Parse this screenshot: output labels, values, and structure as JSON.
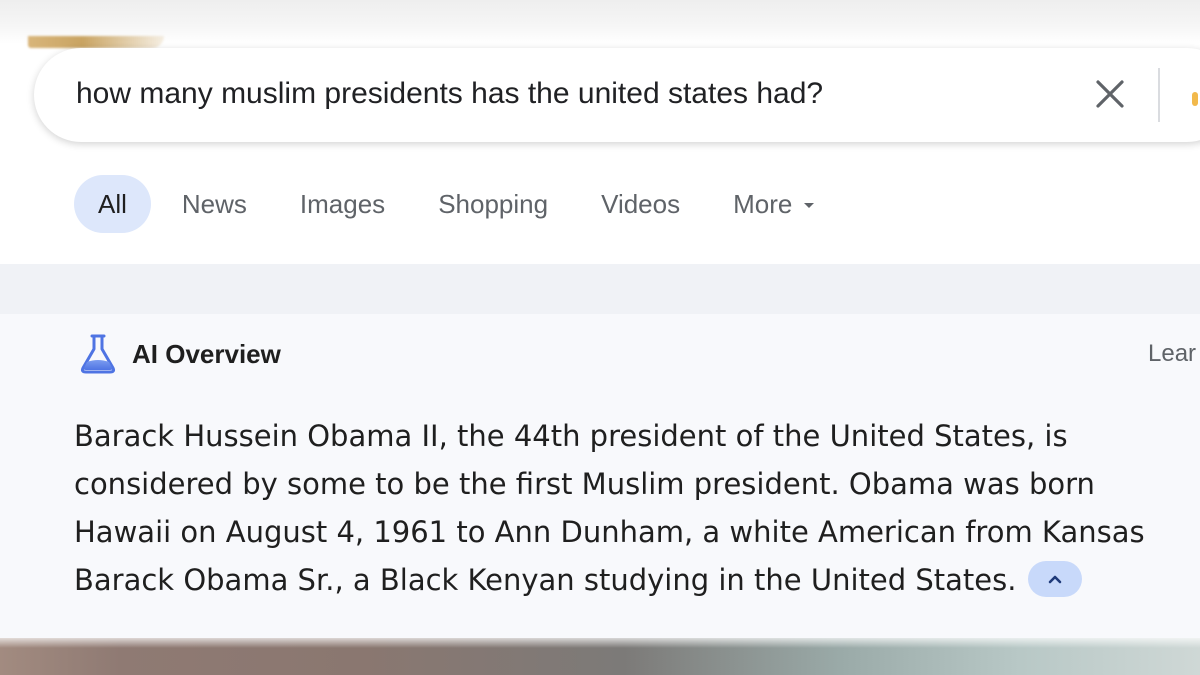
{
  "search": {
    "query": "how many muslim presidents has the united states had?"
  },
  "tabs": [
    {
      "label": "All",
      "active": true
    },
    {
      "label": "News"
    },
    {
      "label": "Images"
    },
    {
      "label": "Shopping"
    },
    {
      "label": "Videos"
    },
    {
      "label": "More"
    }
  ],
  "ai_overview": {
    "title": "AI Overview",
    "learn_more": "Lear",
    "body_lines": [
      "Barack Hussein Obama II, the 44th president of the United States, is",
      "considered by some to be the first Muslim president. Obama was born",
      "Hawaii on August 4, 1961 to Ann Dunham, a white American from Kansas",
      "Barack Obama Sr., a Black Kenyan studying in the United States."
    ]
  },
  "icons": {
    "clear": "close-icon",
    "ai": "flask-icon",
    "collapse": "chevron-up-icon",
    "more": "caret-down-icon"
  },
  "colors": {
    "active_tab_bg": "#dde7fb",
    "ai_icon": "#4f74e3",
    "collapse_bg": "#c8d9fa"
  }
}
